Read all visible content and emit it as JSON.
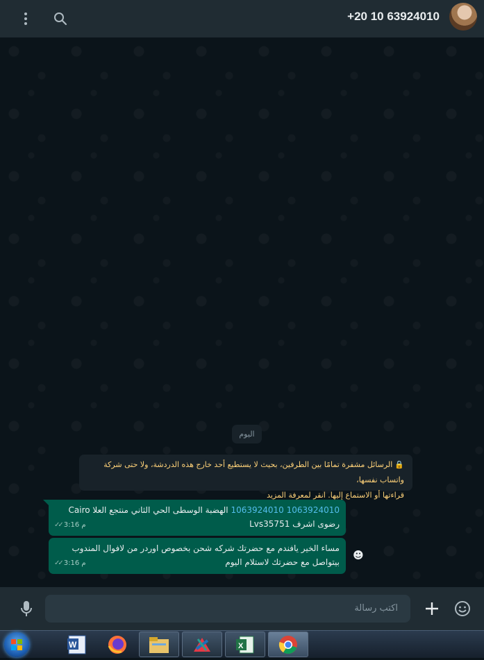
{
  "header": {
    "contact_name": "+20 10 63924010",
    "icons": [
      "menu-icon",
      "search-icon"
    ]
  },
  "chat": {
    "date_label": "اليوم",
    "encryption_notice": {
      "line1": "الرسائل مشفرة تمامًا بين الطرفين، بحيث لا يستطيع أحد خارج هذه الدردشة، ولا حتى شركة واتساب نفسها،",
      "line2": "قراءتها أو الاستماع إليها. انقر لمعرفة المزيد"
    },
    "messages": [
      {
        "links": "1063924010 1063924010",
        "line1_rest": " الهضبة الوسطى الحي الثاني منتجع العلا Cairo",
        "line2": "رضوى اشرف Lvs35751",
        "time": "3:16 م",
        "status": "read"
      },
      {
        "line1": "مساء الخير يافندم مع حضرتك شركه شحن بخصوص اوردر من لافوال المندوب",
        "line2": "بيتواصل مع حضرتك لاستلام اليوم",
        "time": "3:16 م",
        "status": "read"
      }
    ]
  },
  "footer": {
    "placeholder": "اكتب رسالة"
  },
  "taskbar": {
    "apps": [
      "start-button",
      "word-icon",
      "firefox-icon",
      "file-explorer-icon",
      "network-app-icon",
      "excel-icon",
      "chrome-icon"
    ]
  },
  "colors": {
    "background": "#0b141a",
    "panel": "#202c33",
    "outgoing_bubble": "#005c4b",
    "link": "#53bdeb",
    "notice_text": "#ffd279"
  }
}
